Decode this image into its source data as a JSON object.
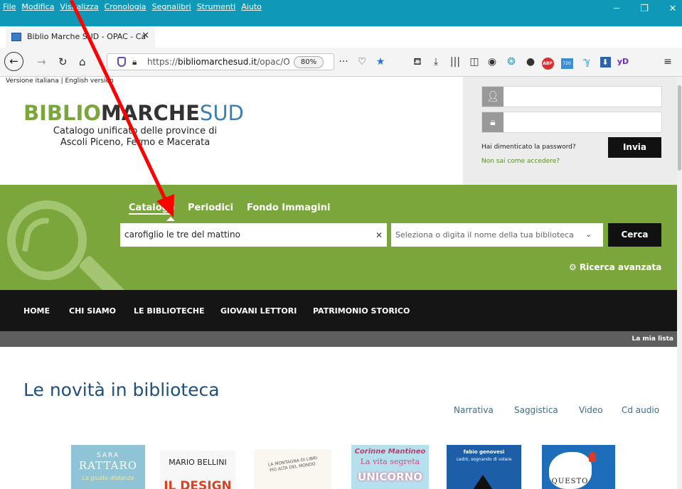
{
  "menubar": {
    "items": [
      "File",
      "Modifica",
      "Visualizza",
      "Cronologia",
      "Segnalibri",
      "Strumenti",
      "Aiuto"
    ]
  },
  "tab": {
    "title": "Biblio Marche SUD - OPAC - Ca"
  },
  "urlbar": {
    "url_prefix": "https://",
    "url_host": "bibliomarchesud.it",
    "url_path": "/opac/Op",
    "zoom": "80%"
  },
  "toolbar_icons": [
    "overflow-icon",
    "pocket-icon",
    "bookmark-star-icon",
    "reading-list-icon",
    "download-icon",
    "library-icon",
    "sidebar-icon",
    "account-icon",
    "extension-icon",
    "extension-icon",
    "adblock-icon",
    "extension-icon",
    "extension-icon",
    "extension-icon",
    "extension-icon",
    "menu-icon"
  ],
  "toolbar_labels": {
    "abp": "ABP",
    "badge720": "720",
    "yd": "yD"
  },
  "header": {
    "language_links": "Versione italiana | English version",
    "logo_biblio": "BIBLIO",
    "logo_marche": "MARCHE",
    "logo_sud": "SUD",
    "tagline_1": "Catalogo unificato delle province di",
    "tagline_2": "Ascoli Piceno, Fermo e Macerata"
  },
  "login": {
    "forgot": "Hai dimenticato la password?",
    "access": "Non sai come accedere?",
    "submit": "Invia"
  },
  "search": {
    "tabs": [
      "Catalogo",
      "Periodici",
      "Fondo Immagini"
    ],
    "query": "carofiglio le tre del mattino",
    "library_placeholder": "Seleziona o digita il nome della tua biblioteca",
    "submit": "Cerca",
    "advanced": "Ricerca avanzata"
  },
  "nav": {
    "items": [
      "HOME",
      "CHI SIAMO",
      "LE BIBLIOTECHE",
      "GIOVANI LETTORI",
      "PATRIMONIO STORICO"
    ],
    "my_list": "La mia lista"
  },
  "news": {
    "title": "Le novità in biblioteca",
    "categories": [
      "Narrativa",
      "Saggistica",
      "Video",
      "Cd audio"
    ]
  },
  "books": [
    {
      "line1": "SARA",
      "line2": "RATTARO",
      "line3": "La giusta distanza",
      "bg": "#8fc3d6",
      "fg": "#ffffff"
    },
    {
      "line1": "MARIO BELLINI",
      "line2": "IL DESIGN",
      "bg": "#f7f7f7",
      "fg": "#222222",
      "accent": "#e04020"
    },
    {
      "line1": "LA MONTAGNA DI LIBRI",
      "line2": "PIÙ ALTA DEL MONDO",
      "bg": "#faf7f0",
      "fg": "#555555"
    },
    {
      "line1": "Corinne Mantineo",
      "line2": "La vita segreta",
      "line3": "UNICORNO",
      "bg": "#b7e0ee",
      "fg": "#c03a6a"
    },
    {
      "line1": "fabio genovesi",
      "line2": "cadrò, sognando di volare",
      "bg": "#1c5ea8",
      "fg": "#ffffff"
    },
    {
      "line1": "QUESTO",
      "bg": "#1e6dbb",
      "fg": "#222222"
    }
  ]
}
